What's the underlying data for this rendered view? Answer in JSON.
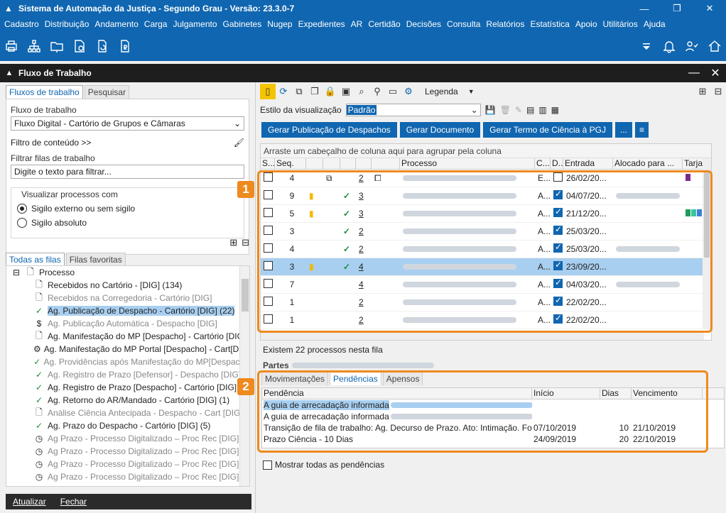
{
  "window": {
    "title": "Sistema de Automação da Justiça - Segundo Grau - Versão: 23.3.0-7"
  },
  "menu": [
    "Cadastro",
    "Distribuição",
    "Andamento",
    "Carga",
    "Julgamento",
    "Gabinetes",
    "Nugep",
    "Expedientes",
    "AR",
    "Certidão",
    "Decisões",
    "Consulta",
    "Relatórios",
    "Estatística",
    "Apoio",
    "Utilitários",
    "Ajuda"
  ],
  "panel": {
    "title": "Fluxo de Trabalho"
  },
  "left": {
    "tabs": [
      "Fluxos de trabalho",
      "Pesquisar"
    ],
    "fluxo_label": "Fluxo de trabalho",
    "fluxo_value": "Fluxo Digital - Cartório de Grupos e Câmaras",
    "filtro_conteudo": "Filtro de conteúdo >>",
    "filtrar_label": "Filtrar filas de trabalho",
    "filtrar_placeholder": "Digite o texto para filtrar...",
    "visualizar_legend": "Visualizar processos com",
    "radio_externo": "Sigilo externo ou sem sigilo",
    "radio_absoluto": "Sigilo absoluto",
    "queue_tabs": [
      "Todas as filas",
      "Filas favoritas"
    ],
    "tree": [
      {
        "label": "Processo",
        "icon": "doc",
        "dim": false,
        "sel": false,
        "indent": 0,
        "expander": "⊟"
      },
      {
        "label": "Recebidos no Cartório - [DIG] (134)",
        "icon": "doc",
        "dim": false,
        "sel": false,
        "indent": 1
      },
      {
        "label": "Recebidos na Corregedoria - Cartório [DIG]",
        "icon": "doc",
        "dim": true,
        "sel": false,
        "indent": 1
      },
      {
        "label": "Ag. Publicação de Despacho - Cartório [DIG] (22)",
        "icon": "check",
        "dim": false,
        "sel": true,
        "indent": 1
      },
      {
        "label": "Ag. Publicação Automática - Despacho [DIG]",
        "icon": "dollar",
        "dim": true,
        "sel": false,
        "indent": 1
      },
      {
        "label": "Ag. Manifestação do MP [Despacho] - Cartório [DIG]",
        "icon": "doc",
        "dim": false,
        "sel": false,
        "indent": 1
      },
      {
        "label": "Ag. Manifestação do MP Portal [Despacho] - Cart[DIG]",
        "icon": "gear",
        "dim": false,
        "sel": false,
        "indent": 1
      },
      {
        "label": "Ag. Providências após Manifestação do MP[Despacho",
        "icon": "check",
        "dim": true,
        "sel": false,
        "indent": 1
      },
      {
        "label": "Ag. Registro de Prazo [Defensor] - Despacho [DIG]",
        "icon": "check",
        "dim": true,
        "sel": false,
        "indent": 1
      },
      {
        "label": "Ag. Registro de Prazo [Despacho] - Cartório [DIG]",
        "icon": "check",
        "dim": false,
        "sel": false,
        "indent": 1
      },
      {
        "label": "Ag. Retorno do AR/Mandado - Cartório [DIG] (1)",
        "icon": "check",
        "dim": false,
        "sel": false,
        "indent": 1
      },
      {
        "label": "Análise Ciência Antecipada - Despacho - Cart [DIG]",
        "icon": "doc",
        "dim": true,
        "sel": false,
        "indent": 1
      },
      {
        "label": "Ag. Prazo do Despacho - Cartório [DIG] (5)",
        "icon": "check",
        "dim": false,
        "sel": false,
        "indent": 1
      },
      {
        "label": "Ag Prazo - Processo Digitalizado – Proc Rec [DIG]",
        "icon": "clock",
        "dim": true,
        "sel": false,
        "indent": 1
      },
      {
        "label": "Ag Prazo - Processo Digitalizado – Proc Rec [DIG]",
        "icon": "clock",
        "dim": true,
        "sel": false,
        "indent": 1
      },
      {
        "label": "Ag Prazo - Processo Digitalizado – Proc Rec [DIG]",
        "icon": "clock",
        "dim": true,
        "sel": false,
        "indent": 1
      },
      {
        "label": "Ag Prazo - Processo Digitalizado – Proc Rec [DIG]",
        "icon": "clock",
        "dim": true,
        "sel": false,
        "indent": 1
      }
    ],
    "bottom_atualizar": "Atualizar",
    "bottom_fechar": "Fechar"
  },
  "right": {
    "legenda": "Legenda",
    "estilo_label": "Estilo da visualização",
    "estilo_value": "Padrão",
    "buttons": [
      "Gerar Publicação de Despachos",
      "Gerar Documento",
      "Gerar Termo de Ciência à PGJ",
      "..."
    ],
    "group_hint": "Arraste um cabeçalho de coluna aqui para agrupar pela coluna",
    "columns": [
      "S...",
      "Seq.",
      "",
      "",
      "",
      "",
      "",
      "Processo",
      "C...",
      "D...",
      "Entrada",
      "Alocado para ...",
      "Tarjas"
    ],
    "rows": [
      {
        "seq": "4",
        "bookmark": false,
        "check": false,
        "num": "2",
        "c": "E...",
        "dchk": false,
        "entrada": "26/02/20...",
        "sel": false,
        "extra": "doc",
        "aloc": false,
        "tarja": [
          "#7b2a8c"
        ]
      },
      {
        "seq": "9",
        "bookmark": true,
        "check": true,
        "num": "3",
        "c": "A...",
        "dchk": true,
        "entrada": "04/07/20...",
        "sel": false,
        "extra": "",
        "aloc": true,
        "tarja": []
      },
      {
        "seq": "5",
        "bookmark": true,
        "check": true,
        "num": "3",
        "c": "A...",
        "dchk": true,
        "entrada": "21/12/20...",
        "sel": false,
        "extra": "",
        "aloc": false,
        "tarja": [
          "#1e9c5a",
          "#37c6a0",
          "#3d7fd6"
        ]
      },
      {
        "seq": "3",
        "bookmark": false,
        "check": true,
        "num": "2",
        "c": "A...",
        "dchk": true,
        "entrada": "25/03/20...",
        "sel": false,
        "extra": "",
        "aloc": false,
        "tarja": []
      },
      {
        "seq": "4",
        "bookmark": false,
        "check": true,
        "num": "2",
        "c": "A...",
        "dchk": true,
        "entrada": "25/03/20...",
        "sel": false,
        "extra": "",
        "aloc": true,
        "tarja": []
      },
      {
        "seq": "3",
        "bookmark": true,
        "check": true,
        "num": "4",
        "c": "A...",
        "dchk": true,
        "entrada": "23/09/20...",
        "sel": true,
        "extra": "",
        "aloc": false,
        "tarja": []
      },
      {
        "seq": "7",
        "bookmark": false,
        "check": false,
        "num": "4",
        "c": "A...",
        "dchk": true,
        "entrada": "04/03/20...",
        "sel": false,
        "extra": "",
        "aloc": true,
        "tarja": []
      },
      {
        "seq": "1",
        "bookmark": false,
        "check": false,
        "num": "2",
        "c": "A...",
        "dchk": true,
        "entrada": "22/02/20...",
        "sel": false,
        "extra": "",
        "aloc": false,
        "tarja": []
      },
      {
        "seq": "1",
        "bookmark": false,
        "check": false,
        "num": "2",
        "c": "A...",
        "dchk": true,
        "entrada": "22/02/20...",
        "sel": false,
        "extra": "",
        "aloc": false,
        "tarja": []
      }
    ],
    "existem": "Existem 22 processos nesta fila",
    "partes_label": "Partes",
    "bottom_tabs": [
      "Movimentações",
      "Pendências",
      "Apensos"
    ],
    "pend_columns": [
      "Pendência",
      "Início",
      "Dias",
      "Vencimento"
    ],
    "pend_rows": [
      {
        "p": "A guia de arrecadação informada",
        "ini": "",
        "dias": "",
        "venc": "",
        "hl": true
      },
      {
        "p": "A guia de arrecadação informada",
        "ini": "",
        "dias": "",
        "venc": "",
        "hl": false
      },
      {
        "p": "Transição de fila de trabalho: Ag. Decurso de Prazo. Ato: Intimação. Forma:",
        "ini": "07/10/2019",
        "dias": "10",
        "venc": "21/10/2019",
        "hl": false
      },
      {
        "p": "Prazo Ciência - 10 Dias",
        "ini": "24/09/2019",
        "dias": "20",
        "venc": "22/10/2019",
        "hl": false
      }
    ],
    "mostrar": "Mostrar todas as pendências",
    "callout1": "1",
    "callout2": "2"
  }
}
